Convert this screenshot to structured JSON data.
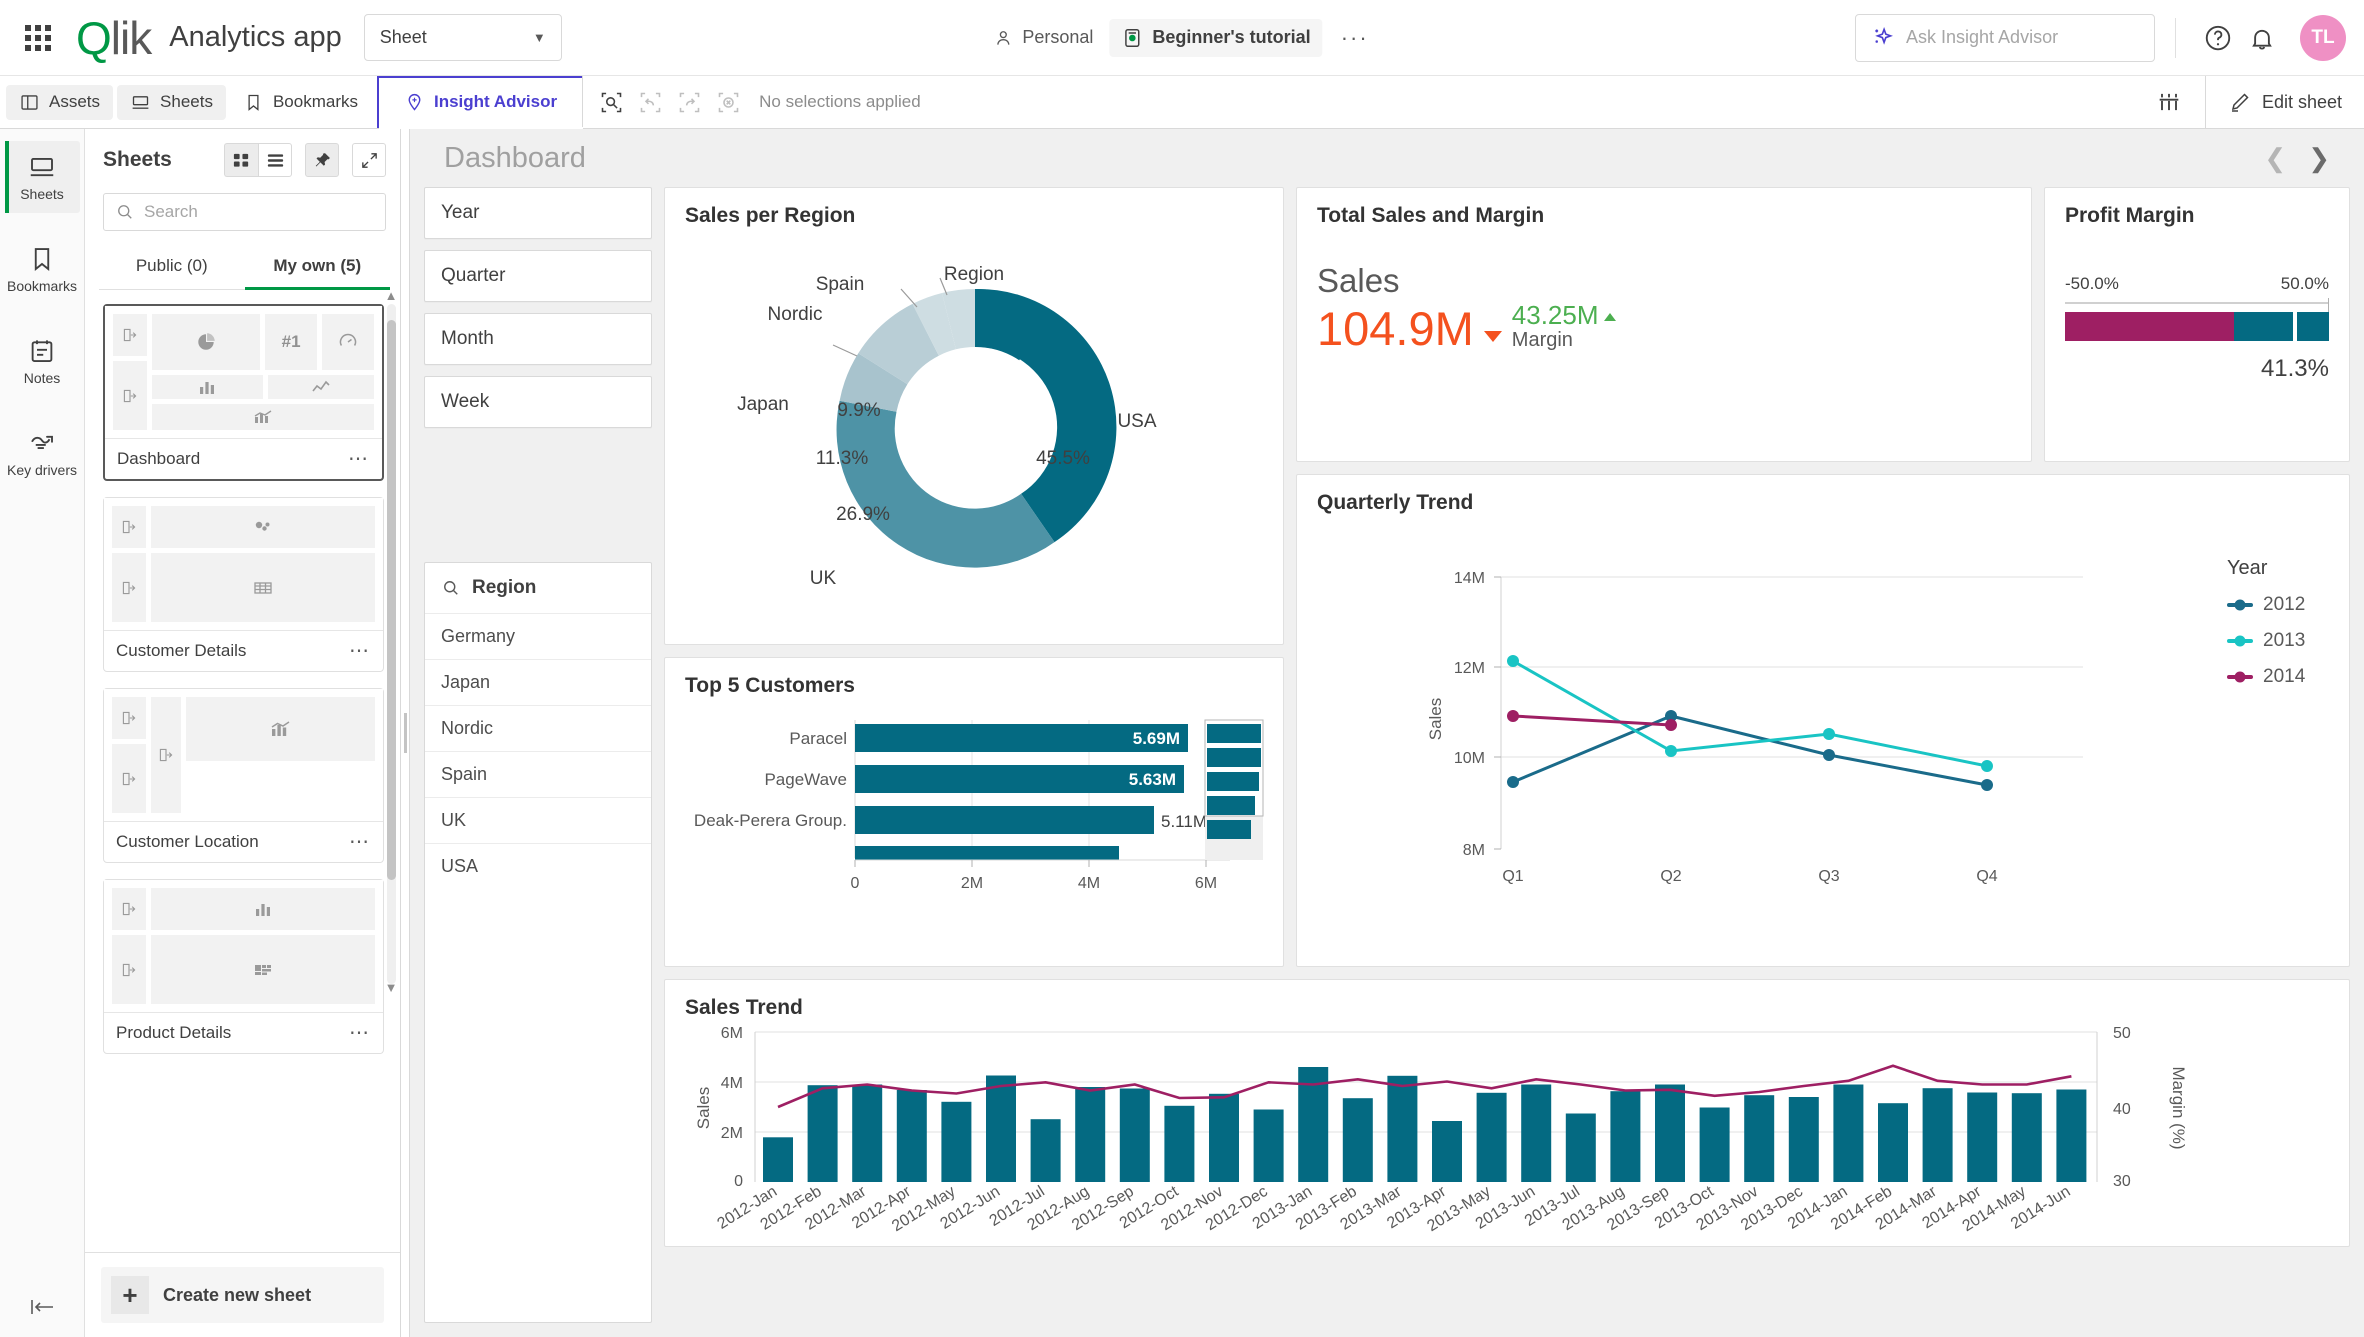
{
  "header": {
    "app_title": "Analytics app",
    "sheet_select": "Sheet",
    "space": "Personal",
    "app_name": "Beginner's tutorial",
    "more": "···",
    "insight_placeholder": "Ask Insight Advisor",
    "avatar_initials": "TL"
  },
  "toolbar": {
    "assets": "Assets",
    "sheets": "Sheets",
    "bookmarks": "Bookmarks",
    "insight_advisor": "Insight Advisor",
    "no_selections": "No selections applied",
    "edit_sheet": "Edit sheet"
  },
  "rail": {
    "items": [
      {
        "label": "Sheets",
        "icon": "sheet-icon",
        "active": true
      },
      {
        "label": "Bookmarks",
        "icon": "bookmark-icon",
        "active": false
      },
      {
        "label": "Notes",
        "icon": "notes-icon",
        "active": false
      },
      {
        "label": "Key drivers",
        "icon": "key-drivers-icon",
        "active": false
      }
    ]
  },
  "sheets_panel": {
    "title": "Sheets",
    "search_placeholder": "Search",
    "tabs": [
      {
        "label": "Public (0)",
        "active": false
      },
      {
        "label": "My own (5)",
        "active": true
      }
    ],
    "sheets": [
      {
        "name": "Dashboard",
        "selected": true
      },
      {
        "name": "Customer Details",
        "selected": false
      },
      {
        "name": "Customer Location",
        "selected": false
      },
      {
        "name": "Product Details",
        "selected": false
      }
    ],
    "create_new": "Create new sheet"
  },
  "sheet": {
    "title": "Dashboard"
  },
  "filters": {
    "boxes": [
      "Year",
      "Quarter",
      "Month",
      "Week"
    ],
    "region_listbox": {
      "title": "Region",
      "values": [
        "Germany",
        "Japan",
        "Nordic",
        "Spain",
        "UK",
        "USA"
      ]
    }
  },
  "chart_data": [
    {
      "id": "sales-per-region",
      "type": "pie",
      "title": "Sales per Region",
      "legend_title": "Region",
      "labels": [
        "USA",
        "UK",
        "Japan",
        "Nordic",
        "Spain"
      ],
      "values": [
        45.5,
        26.9,
        11.3,
        9.9,
        3.2
      ],
      "value_labels": [
        "45.5%",
        "26.9%",
        "11.3%",
        "9.9%",
        ""
      ],
      "colors": [
        "#046a82",
        "#4e93a6",
        "#a8c3cd",
        "#b9ced6",
        "#cedde2"
      ],
      "donut": true
    },
    {
      "id": "top-5-customers",
      "type": "bar",
      "title": "Top 5 Customers",
      "orientation": "horizontal",
      "categories": [
        "Paracel",
        "PageWave",
        "Deak-Perera Group.",
        ""
      ],
      "values": [
        5.69,
        5.63,
        5.11,
        4.52
      ],
      "value_labels": [
        "5.69M",
        "5.63M",
        "5.11M",
        ""
      ],
      "xlabel": "",
      "ylabel": "",
      "xticks": [
        "0",
        "2M",
        "4M",
        "6M"
      ],
      "xlim": [
        0,
        6.0
      ],
      "color": "#046a82",
      "minichart_values": [
        5.69,
        5.63,
        5.11,
        4.52,
        3.9
      ]
    },
    {
      "id": "total-sales-and-margin",
      "type": "kpi",
      "title": "Total Sales and Margin",
      "primary_label": "Sales",
      "primary_value": "104.9M",
      "primary_color": "#f4511e",
      "primary_trend": "down",
      "secondary_value": "43.25M",
      "secondary_label": "Margin",
      "secondary_color": "#4caf50",
      "secondary_trend": "up"
    },
    {
      "id": "profit-margin",
      "type": "bar",
      "title": "Profit Margin",
      "min_label": "-50.0%",
      "max_label": "50.0%",
      "value_label": "41.3%",
      "value": 41.3,
      "range": [
        -50.0,
        50.0
      ],
      "neg_color": "#9e1f63",
      "pos_color": "#046a82"
    },
    {
      "id": "quarterly-trend",
      "type": "line",
      "title": "Quarterly Trend",
      "categories": [
        "Q1",
        "Q2",
        "Q3",
        "Q4"
      ],
      "ylabel": "Sales",
      "yticks": [
        "8M",
        "10M",
        "12M",
        "14M"
      ],
      "ylim": [
        8,
        14
      ],
      "legend_title": "Year",
      "legend_position": "right",
      "series": [
        {
          "name": "2012",
          "color": "#1a6b8a",
          "values": [
            9.48,
            10.95,
            10.08,
            9.42
          ]
        },
        {
          "name": "2013",
          "color": "#19c4c4",
          "values": [
            12.17,
            10.17,
            10.55,
            9.84
          ]
        },
        {
          "name": "2014",
          "color": "#9e1f63",
          "values": [
            10.95,
            10.76,
            null,
            null
          ]
        }
      ]
    },
    {
      "id": "sales-trend",
      "type": "bar",
      "title": "Sales Trend",
      "ylabel": "Sales",
      "y2label": "Margin (%)",
      "yticks": [
        "0",
        "2M",
        "4M",
        "6M"
      ],
      "ylim": [
        0,
        6
      ],
      "y2ticks": [
        "30",
        "40",
        "50"
      ],
      "y2lim": [
        30,
        50
      ],
      "bar_color": "#046a82",
      "line_color": "#9e1f63",
      "categories": [
        "2012-Jan",
        "2012-Feb",
        "2012-Mar",
        "2012-Apr",
        "2012-May",
        "2012-Jun",
        "2012-Jul",
        "2012-Aug",
        "2012-Sep",
        "2012-Oct",
        "2012-Nov",
        "2012-Dec",
        "2013-Jan",
        "2013-Feb",
        "2013-Mar",
        "2013-Apr",
        "2013-May",
        "2013-Jun",
        "2013-Jul",
        "2013-Aug",
        "2013-Sep",
        "2013-Oct",
        "2013-Nov",
        "2013-Dec",
        "2014-Jan",
        "2014-Feb",
        "2014-Mar",
        "2014-Apr",
        "2014-May",
        "2014-Jun"
      ],
      "series": [
        {
          "name": "Sales",
          "type": "bar",
          "values": [
            1.79,
            3.87,
            3.9,
            3.68,
            3.21,
            4.26,
            2.51,
            3.8,
            3.74,
            3.05,
            3.53,
            2.9,
            4.6,
            3.35,
            4.25,
            2.44,
            3.57,
            3.9,
            2.74,
            3.63,
            3.9,
            2.98,
            3.47,
            3.4,
            3.9,
            3.15,
            3.75,
            3.58,
            3.55,
            3.7
          ]
        },
        {
          "name": "Margin",
          "type": "line",
          "axis": "right",
          "values": [
            40.0,
            42.5,
            43.0,
            42.2,
            41.8,
            42.8,
            43.3,
            42.2,
            43.0,
            41.2,
            41.3,
            43.3,
            43.0,
            43.7,
            42.8,
            43.4,
            42.5,
            43.7,
            43.0,
            42.2,
            42.3,
            41.5,
            42.0,
            42.8,
            43.5,
            45.5,
            43.5,
            43.0,
            43.0,
            43.7
          ]
        }
      ]
    }
  ]
}
